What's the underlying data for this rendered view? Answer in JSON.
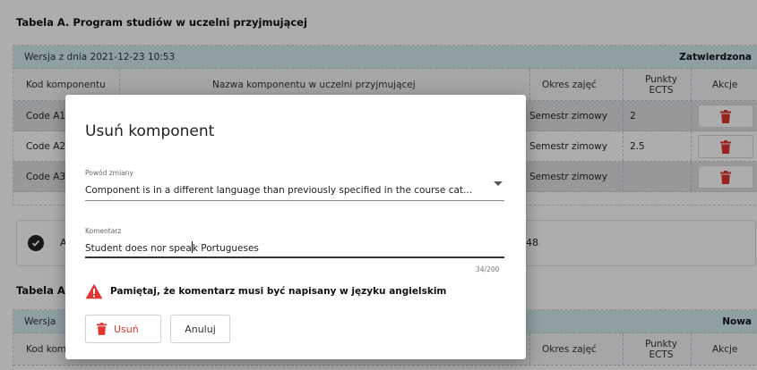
{
  "tableA": {
    "title": "Tabela A. Program studiów w uczelni przyjmującej",
    "version_text": "Wersja z dnia 2021-12-23 10:53",
    "status": "Zatwierdzona",
    "headers": {
      "code": "Kod komponentu",
      "name": "Nazwa komponentu w uczelni przyjmującej",
      "period": "Okres zajęć",
      "ects_line1": "Punkty",
      "ects_line2": "ECTS",
      "actions": "Akcje"
    },
    "rows": [
      {
        "code": "Code A1",
        "period": "Semestr zimowy",
        "ects": "2"
      },
      {
        "code": "Code A2",
        "period": "Semestr zimowy",
        "ects": "2.5"
      },
      {
        "code": "Code A3",
        "period": "Semestr zimowy",
        "ects": ""
      }
    ]
  },
  "summary": {
    "prefix": "A",
    "number": "48"
  },
  "tableA2": {
    "title_partial": "Tabela A",
    "version_partial": "Wersja",
    "status": "Nowa",
    "headers": {
      "code_partial": "Kod kom",
      "period": "Okres zajęć",
      "ects_line1": "Punkty",
      "ects_line2": "ECTS",
      "actions": "Akcje"
    }
  },
  "dialog": {
    "title": "Usuń komponent",
    "reason_label": "Powód zmiany",
    "reason_value": "Component is in a different language than previously specified in the course cat...",
    "comment_label": "Komentarz",
    "comment_before_caret": "Student ",
    "comment_word_does": "does",
    "comment_mid": " nor ",
    "comment_speak_a": "spea",
    "comment_speak_b": "k",
    "comment_space": " ",
    "comment_word_portugueses": "Portugueses",
    "counter": "34/200",
    "warning": "Pamiętaj, że komentarz musi być napisany w języku angielskim",
    "delete_button": "Usuń",
    "cancel_button": "Anuluj"
  },
  "colors": {
    "accent_red": "#e03530",
    "version_bar": "#d3ecf1",
    "overlay": "rgba(0,0,0,0.32)"
  },
  "icons": {
    "delete": "trash-icon",
    "check": "check-circle-icon",
    "warning": "warning-triangle-icon",
    "dropdown": "chevron-down-icon"
  }
}
